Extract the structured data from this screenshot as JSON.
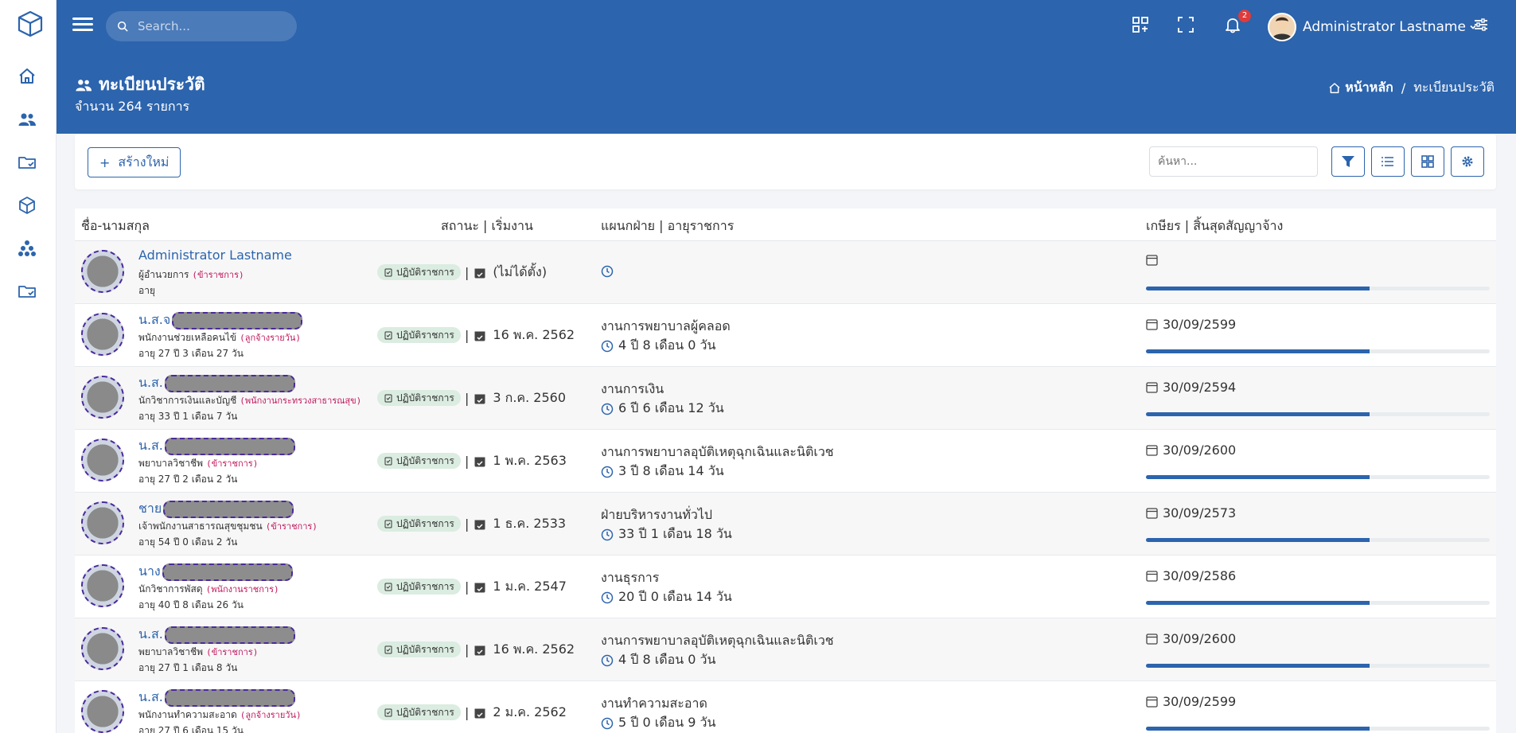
{
  "colors": {
    "primary": "#2c64ad",
    "badge": "#e03b3b",
    "status_bg": "#dbece1",
    "employment_type": "#c2185b"
  },
  "sidebar": {
    "items": [
      {
        "icon": "home-icon"
      },
      {
        "icon": "users-icon"
      },
      {
        "icon": "folder-check-icon"
      },
      {
        "icon": "box-icon"
      },
      {
        "icon": "sitemap-icon"
      },
      {
        "icon": "folder-check-icon"
      }
    ]
  },
  "header": {
    "search_placeholder": "Search...",
    "notification_count": "2",
    "user_name": "Administrator Lastname",
    "page_title": "ทะเบียนประวัติ",
    "page_count": "จำนวน 264 รายการ",
    "breadcrumb": {
      "home": "หน้าหลัก",
      "current": "ทะเบียนประวัติ"
    }
  },
  "toolbar": {
    "new_label": "สร้างใหม่",
    "search_placeholder": "ค้นหา..."
  },
  "table": {
    "headers": {
      "name": "ชื่อ-นามสกุล",
      "status": "สถานะ | เริ่มงาน",
      "dept": "แผนกฝ่าย | อายุราชการ",
      "retire": "เกษียร | สิ้นสุดสัญญาจ้าง"
    },
    "rows": [
      {
        "name": "Administrator Lastname",
        "redacted": false,
        "position": "ผู้อำนวยการ",
        "type": "(ข้าราชการ)",
        "age": "อายุ",
        "status": "ปฏิบัติราชการ",
        "start": "(ไม่ได้ตั้ง)",
        "dept": "",
        "tenure": "",
        "retire": "",
        "progress": 0.65
      },
      {
        "name": "น.ส.จ",
        "redacted": true,
        "position": "พนักงานช่วยเหลือคนไข้",
        "type": "(ลูกจ้างรายวัน)",
        "age": "อายุ 27 ปี 3 เดือน 27 วัน",
        "status": "ปฏิบัติราชการ",
        "start": "16 พ.ค. 2562",
        "dept": "งานการพยาบาลผู้คลอด",
        "tenure": "4 ปี 8 เดือน 0 วัน",
        "retire": "30/09/2599",
        "progress": 0.65
      },
      {
        "name": "น.ส.",
        "redacted": true,
        "position": "นักวิชาการเงินและบัญชี",
        "type": "(พนักงานกระทรวงสาธารณสุข)",
        "age": "อายุ 33 ปี 1 เดือน 7 วัน",
        "status": "ปฏิบัติราชการ",
        "start": "3 ก.ค. 2560",
        "dept": "งานการเงิน",
        "tenure": "6 ปี 6 เดือน 12 วัน",
        "retire": "30/09/2594",
        "progress": 0.65
      },
      {
        "name": "น.ส.",
        "redacted": true,
        "position": "พยาบาลวิชาชีพ",
        "type": "(ข้าราชการ)",
        "age": "อายุ 27 ปี 2 เดือน 2 วัน",
        "status": "ปฏิบัติราชการ",
        "start": "1 พ.ค. 2563",
        "dept": "งานการพยาบาลอุบัติเหตุฉุกเฉินและนิติเวช",
        "tenure": "3 ปี 8 เดือน 14 วัน",
        "retire": "30/09/2600",
        "progress": 0.65
      },
      {
        "name": "ชาย",
        "redacted": true,
        "position": "เจ้าพนักงานสาธารณสุขชุมชน",
        "type": "(ข้าราชการ)",
        "age": "อายุ 54 ปี 0 เดือน 2 วัน",
        "status": "ปฏิบัติราชการ",
        "start": "1 ธ.ค. 2533",
        "dept": "ฝ่ายบริหารงานทั่วไป",
        "tenure": "33 ปี 1 เดือน 18 วัน",
        "retire": "30/09/2573",
        "progress": 0.65
      },
      {
        "name": "นาง",
        "redacted": true,
        "position": "นักวิชาการพัสดุ",
        "type": "(พนักงานราชการ)",
        "age": "อายุ 40 ปี 8 เดือน 26 วัน",
        "status": "ปฏิบัติราชการ",
        "start": "1 ม.ค. 2547",
        "dept": "งานธุรการ",
        "tenure": "20 ปี 0 เดือน 14 วัน",
        "retire": "30/09/2586",
        "progress": 0.65
      },
      {
        "name": "น.ส.",
        "redacted": true,
        "position": "พยาบาลวิชาชีพ",
        "type": "(ข้าราชการ)",
        "age": "อายุ 27 ปี 1 เดือน 8 วัน",
        "status": "ปฏิบัติราชการ",
        "start": "16 พ.ค. 2562",
        "dept": "งานการพยาบาลอุบัติเหตุฉุกเฉินและนิติเวช",
        "tenure": "4 ปี 8 เดือน 0 วัน",
        "retire": "30/09/2600",
        "progress": 0.65
      },
      {
        "name": "น.ส.",
        "redacted": true,
        "position": "พนักงานทำความสะอาด",
        "type": "(ลูกจ้างรายวัน)",
        "age": "อายุ 27 ปี 6 เดือน 15 วัน",
        "status": "ปฏิบัติราชการ",
        "start": "2 ม.ค. 2562",
        "dept": "งานทำความสะอาด",
        "tenure": "5 ปี 0 เดือน 9 วัน",
        "retire": "30/09/2599",
        "progress": 0.65
      }
    ]
  }
}
